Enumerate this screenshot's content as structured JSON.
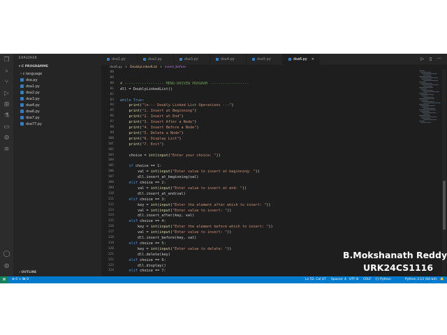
{
  "sidebar": {
    "title": "EXPLORER",
    "root": "C PROGRAMME",
    "items": [
      {
        "label": "c language",
        "kind": "folder"
      },
      {
        "label": "dsa.py",
        "kind": "py"
      },
      {
        "label": "dsa1.py",
        "kind": "py"
      },
      {
        "label": "dsa2.py",
        "kind": "py"
      },
      {
        "label": "dsa3.py",
        "kind": "py"
      },
      {
        "label": "dsa4.py",
        "kind": "py"
      },
      {
        "label": "dsa6.py",
        "kind": "py"
      },
      {
        "label": "dsa7.py",
        "kind": "py"
      },
      {
        "label": "dsa77.py",
        "kind": "py"
      }
    ],
    "outline": "OUTLINE"
  },
  "tabs": [
    {
      "label": "dsa1.py",
      "active": false
    },
    {
      "label": "dsa2.py",
      "active": false
    },
    {
      "label": "dsa3.py",
      "active": false
    },
    {
      "label": "dsa4.py",
      "active": false
    },
    {
      "label": "dsa5.py",
      "active": false
    },
    {
      "label": "dsa6.py",
      "active": true
    }
  ],
  "tab_close": "×",
  "breadcrumb": {
    "file": "dsa6.py",
    "sep": ">",
    "cls": "DoublyLinkedList",
    "method": "insert_before"
  },
  "editor": {
    "lines": [
      {
        "n": "88",
        "t": ""
      },
      {
        "n": "89",
        "t": ""
      },
      {
        "n": "80",
        "t": "# ------------------ MENU-DRIVEN PROGRAM ------------------"
      },
      {
        "n": "81",
        "t": "dll = DoublyLinkedList()"
      },
      {
        "n": "82",
        "t": ""
      },
      {
        "n": "83",
        "t": "while True:"
      },
      {
        "n": "94",
        "t": "    print(\"\\n--- Doubly Linked List Operations ---\")"
      },
      {
        "n": "95",
        "t": "    print(\"1. Insert at Beginning\")"
      },
      {
        "n": "96",
        "t": "    print(\"2. Insert at End\")"
      },
      {
        "n": "97",
        "t": "    print(\"3. Insert After a Node\")"
      },
      {
        "n": "98",
        "t": "    print(\"4. Insert Before a Node\")"
      },
      {
        "n": "99",
        "t": "    print(\"5. Delete a Node\")"
      },
      {
        "n": "100",
        "t": "    print(\"6. Display List\")"
      },
      {
        "n": "101",
        "t": "    print(\"7. Exit\")"
      },
      {
        "n": "102",
        "t": ""
      },
      {
        "n": "103",
        "t": "    choice = int(input(\"Enter your choice: \"))"
      },
      {
        "n": "104",
        "t": ""
      },
      {
        "n": "105",
        "t": "    if choice == 1:"
      },
      {
        "n": "106",
        "t": "        val = int(input(\"Enter value to insert at beginning: \"))"
      },
      {
        "n": "107",
        "t": "        dll.insert_at_beginning(val)"
      },
      {
        "n": "108",
        "t": "    elif choice == 2:"
      },
      {
        "n": "109",
        "t": "        val = int(input(\"Enter value to insert at end: \"))"
      },
      {
        "n": "110",
        "t": "        dll.insert_at_end(val)"
      },
      {
        "n": "111",
        "t": "    elif choice == 3:"
      },
      {
        "n": "112",
        "t": "        key = int(input(\"Enter the element after which to insert: \"))"
      },
      {
        "n": "113",
        "t": "        val = int(input(\"Enter value to insert: \"))"
      },
      {
        "n": "114",
        "t": "        dll.insert_after(key, val)"
      },
      {
        "n": "115",
        "t": "    elif choice == 4:"
      },
      {
        "n": "116",
        "t": "        key = int(input(\"Enter the element before which to insert: \"))"
      },
      {
        "n": "117",
        "t": "        val = int(input(\"Enter value to insert: \"))"
      },
      {
        "n": "118",
        "t": "        dll.insert_before(key, val)"
      },
      {
        "n": "119",
        "t": "    elif choice == 5:"
      },
      {
        "n": "120",
        "t": "        key = int(input(\"Enter value to delete: \"))"
      },
      {
        "n": "121",
        "t": "        dll.delete(key)"
      },
      {
        "n": "122",
        "t": "    elif choice == 6:"
      },
      {
        "n": "123",
        "t": "        dll.display()"
      },
      {
        "n": "124",
        "t": "    elif choice == 7:"
      }
    ]
  },
  "statusbar": {
    "remote": "⌘",
    "problems": "⊗ 0 ⚠ 0",
    "ports": "⊘ 0",
    "position": "Ln 52, Col 47",
    "spaces": "Spaces: 4",
    "encoding": "UTF-8",
    "eol": "CRLF",
    "language": "{} Python",
    "interpreter": "Python 3.13 (64-bit)",
    "bell": "🔔"
  },
  "overlay": {
    "name": "B.Mokshanath Reddy",
    "id": "URK24CS1116"
  },
  "colors": {
    "statusbar": "#007acc",
    "editor_bg": "#1e1e1e",
    "sidebar_bg": "#252526",
    "keyword": "#569cd6",
    "string": "#ce9178",
    "function": "#dcdcaa",
    "comment": "#6a9955"
  },
  "icons": [
    "files-icon",
    "search-icon",
    "source-control-icon",
    "run-debug-icon",
    "extensions-icon",
    "testing-icon",
    "python-icon",
    "remote-explorer-icon",
    "account-icon",
    "settings-gear-icon"
  ]
}
